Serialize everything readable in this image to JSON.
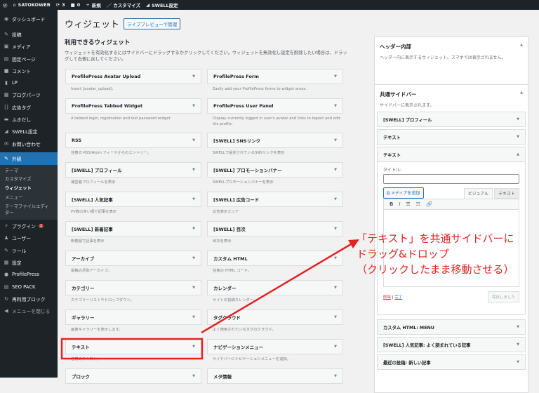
{
  "adminbar": {
    "site": "SATOKOWEB",
    "updates": "3",
    "comments": "0",
    "new": "新規",
    "customize": "カスタマイズ",
    "swell": "SWELL設定"
  },
  "sidebar": {
    "items": [
      "ダッシュボード",
      "投稿",
      "メディア",
      "固定ページ",
      "コメント",
      "LP",
      "ブログパーツ",
      "広告タグ",
      "ふきだし",
      "SWELL設定",
      "お問い合わせ",
      "外観"
    ],
    "sub": [
      "テーマ",
      "カスタマイズ",
      "ウィジェット",
      "メニュー",
      "テーマファイルエディター"
    ],
    "items2": [
      "プラグイン",
      "ユーザー",
      "ツール",
      "設定",
      "ProfilePress",
      "SEO PACK",
      "再利用ブロック",
      "メニューを閉じる"
    ],
    "plugin_badge": "2"
  },
  "page": {
    "title": "ウィジェット",
    "live_preview": "ライブプレビューで管理",
    "available": "利用できるウィジェット",
    "intro": "ウィジェットを有効化するにはサイドバーにドラッグするかクリックしてください。ウィジェットを無効化し設定を削除したい場合は、ドラッグして右側に戻してください。"
  },
  "widgets": [
    {
      "name": "ProfilePress Avatar Upload",
      "desc": "Insert [avatar_upload]."
    },
    {
      "name": "ProfilePress Form",
      "desc": "Easily add your ProfilePress forms to widget areas."
    },
    {
      "name": "ProfilePress Tabbed Widget",
      "desc": "A tabbed login, registration and lost password widget"
    },
    {
      "name": "ProfilePress User Panel",
      "desc": "Display currently logged in user's avatar and links to logout and edit the profile."
    },
    {
      "name": "RSS",
      "desc": "任意の RSS/Atom フィードからのエントリー。"
    },
    {
      "name": "[SWELL] SNSリンク",
      "desc": "SWELLで設定されているSNSリンクを表示"
    },
    {
      "name": "[SWELL] プロフィール",
      "desc": "運営者プロフィールを表示"
    },
    {
      "name": "[SWELL] プロモーションバナー",
      "desc": "SWELLプロモーションバナーを表示"
    },
    {
      "name": "[SWELL] 人気記事",
      "desc": "PV数の多い順で記事を表示"
    },
    {
      "name": "[SWELL] 広告コード",
      "desc": "広告表示エリア"
    },
    {
      "name": "[SWELL] 新着記事",
      "desc": "新着順で記事を表示"
    },
    {
      "name": "[SWELL] 目次",
      "desc": "目次を表示"
    },
    {
      "name": "アーカイブ",
      "desc": "投稿の月別アーカイブ。"
    },
    {
      "name": "カスタム HTML",
      "desc": "任意の HTML コード。"
    },
    {
      "name": "カテゴリー",
      "desc": "カテゴリーリストやドロップダウン。"
    },
    {
      "name": "カレンダー",
      "desc": "サイトの投稿カレンダー。"
    },
    {
      "name": "ギャラリー",
      "desc": "画像ギャラリーを表示します。"
    },
    {
      "name": "タグクラウド",
      "desc": "よく使用されているタグのクラウド。"
    },
    {
      "name": "テキスト",
      "desc": "任意のテキスト。"
    },
    {
      "name": "ナビゲーションメニュー",
      "desc": "サイドバーにナビゲーションメニューを追加。"
    },
    {
      "name": "ブロック",
      "desc": ""
    },
    {
      "name": "メタ情報",
      "desc": ""
    }
  ],
  "header_area": {
    "title": "ヘッダー内部",
    "desc": "ヘッダー内に表示するウィジェット。スマホでは表示されません。"
  },
  "common_sidebar": {
    "title": "共通サイドバー",
    "desc": "サイドバーに表示されます。",
    "widgets_top": [
      "[SWELL] プロフィール",
      "テキスト"
    ],
    "open_widget": {
      "name": "テキスト",
      "title_label": "タイトル:",
      "title_value": "",
      "add_media": "メディアを追加",
      "tab_visual": "ビジュアル",
      "tab_text": "テキスト",
      "delete": "削除",
      "done": "完了",
      "saved": "保存しました"
    },
    "widgets_bottom": [
      "カスタム HTML: MENU",
      "[SWELL] 人気記事: よく読まれている記事",
      "最近の投稿: 新しい記事"
    ]
  },
  "annotation": {
    "line1": "「テキスト」を共通サイドバーに",
    "line2": "ドラッグ&ドロップ",
    "line3": "（クリックしたまま移動させる）",
    "color": "#e02424"
  }
}
